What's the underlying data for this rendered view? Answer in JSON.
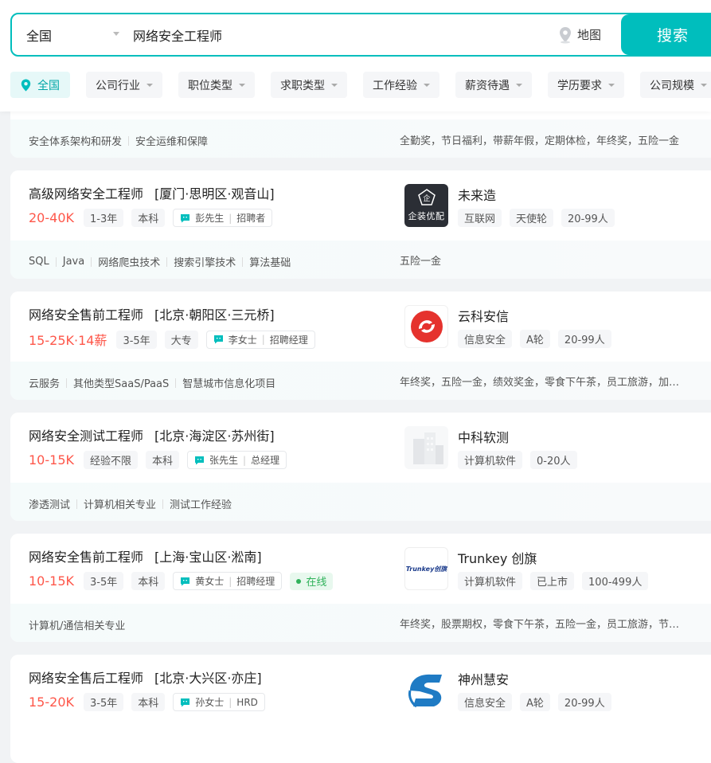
{
  "search": {
    "city": "全国",
    "query": "网络安全工程师",
    "map_label": "地图",
    "button_label": "搜索"
  },
  "filters": [
    "全国",
    "公司行业",
    "职位类型",
    "求职类型",
    "工作经验",
    "薪资待遇",
    "学历要求",
    "公司规模"
  ],
  "partial_card": {
    "skills": [
      "安全体系架构和研发",
      "安全运维和保障"
    ],
    "welfare": "全勤奖，节日福利，带薪年假，定期体检，年终奖，五险一金"
  },
  "jobs": [
    {
      "title": "高级网络安全工程师",
      "area": "[厦门·思明区·观音山]",
      "salary": "20-40K",
      "experience": "1-3年",
      "degree": "本科",
      "recruiter": "彭先生",
      "recruiter_role": "招聘者",
      "online": "",
      "skills": [
        "SQL",
        "Java",
        "网络爬虫技术",
        "搜索引擎技术",
        "算法基础"
      ],
      "welfare": "五险一金",
      "company": "未来造",
      "logo_text": "企装优配",
      "company_tags": [
        "互联网",
        "天使轮",
        "20-99人"
      ]
    },
    {
      "title": "网络安全售前工程师",
      "area": "[北京·朝阳区·三元桥]",
      "salary": "15-25K·14薪",
      "experience": "3-5年",
      "degree": "大专",
      "recruiter": "李女士",
      "recruiter_role": "招聘经理",
      "online": "",
      "skills": [
        "云服务",
        "其他类型SaaS/PaaS",
        "智慧城市信息化项目"
      ],
      "welfare": "年终奖，五险一金，绩效奖金，零食下午茶，员工旅游，加班补助",
      "company": "云科安信",
      "company_tags": [
        "信息安全",
        "A轮",
        "20-99人"
      ]
    },
    {
      "title": "网络安全测试工程师",
      "area": "[北京·海淀区·苏州街]",
      "salary": "10-15K",
      "experience": "经验不限",
      "degree": "本科",
      "recruiter": "张先生",
      "recruiter_role": "总经理",
      "online": "",
      "skills": [
        "渗透测试",
        "计算机相关专业",
        "测试工作经验"
      ],
      "welfare": "",
      "company": "中科软测",
      "company_tags": [
        "计算机软件",
        "0-20人"
      ]
    },
    {
      "title": "网络安全售前工程师",
      "area": "[上海·宝山区·淞南]",
      "salary": "10-15K",
      "experience": "3-5年",
      "degree": "本科",
      "recruiter": "黄女士",
      "recruiter_role": "招聘经理",
      "online": "在线",
      "skills": [
        "计算机/通信相关专业"
      ],
      "welfare": "年终奖，股票期权，零食下午茶，五险一金，员工旅游，节日福利",
      "company": "Trunkey 创旗",
      "logo_text": "Trunkey创旗",
      "company_tags": [
        "计算机软件",
        "已上市",
        "100-499人"
      ]
    },
    {
      "title": "网络安全售后工程师",
      "area": "[北京·大兴区·亦庄]",
      "salary": "15-20K",
      "experience": "3-5年",
      "degree": "本科",
      "recruiter": "孙女士",
      "recruiter_role": "HRD",
      "online": "",
      "skills": [],
      "welfare": "",
      "company": "神州慧安",
      "company_tags": [
        "信息安全",
        "A轮",
        "20-99人"
      ]
    }
  ],
  "colors": {
    "accent": "#00bebd",
    "salary": "#fe574a",
    "online": "#2fb25a"
  }
}
